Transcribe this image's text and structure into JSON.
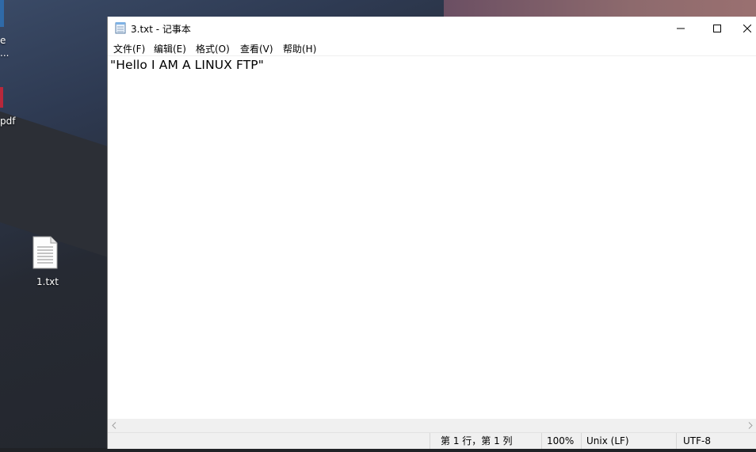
{
  "desktop": {
    "partial_text_top": "e",
    "partial_text_dots": "...",
    "partial_text_pdf": "pdf",
    "file_icon_label": "1.txt"
  },
  "window": {
    "title": "3.txt - 记事本",
    "menu": [
      "文件(F)",
      "编辑(E)",
      "格式(O)",
      "查看(V)",
      "帮助(H)"
    ],
    "content": "\"Hello I AM A LINUX FTP\"",
    "status": {
      "position": "第 1 行，第 1 列",
      "zoom": "100%",
      "line_ending": "Unix (LF)",
      "encoding": "UTF-8"
    }
  },
  "icons": {
    "app": "notepad-icon",
    "minimize": "minimize-icon",
    "maximize": "maximize-icon",
    "close": "close-icon",
    "scroll_left": "chevron-left-icon",
    "scroll_right": "chevron-right-icon",
    "text_file": "text-file-icon"
  },
  "colors": {
    "window_bg": "#ffffff",
    "chrome_bg": "#f0f0f0"
  }
}
